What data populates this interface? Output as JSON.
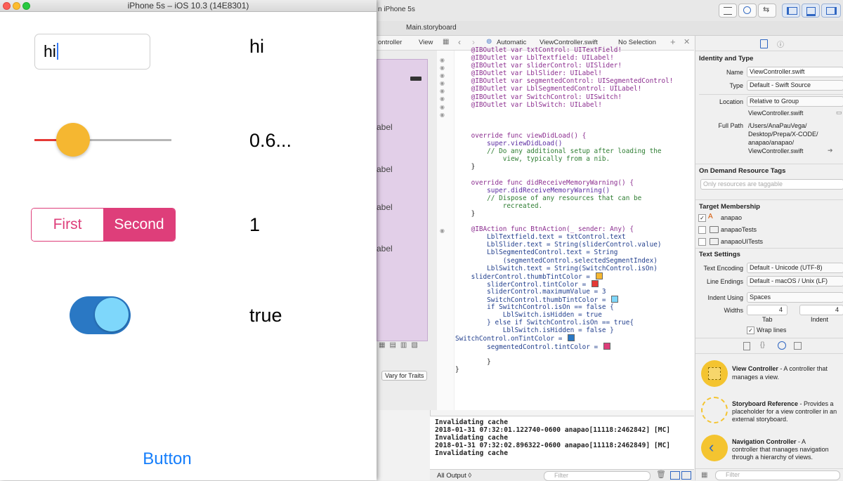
{
  "simulator": {
    "window_title": "iPhone 5s – iOS 10.3 (14E8301)",
    "textfield_value": "hi",
    "textfield_label": "hi",
    "slider": {
      "value_fraction": 0.16,
      "label": "0.6...",
      "min_track_color": "#e53935",
      "thumb_color": "#f5b731"
    },
    "segmented": {
      "items": [
        "First",
        "Second"
      ],
      "selected_index": 1,
      "label": "1",
      "tint": "#de3e7a"
    },
    "switch": {
      "is_on": true,
      "label": "true",
      "on_tint": "#2a78c4",
      "thumb_tint": "#7ed7fb"
    },
    "button_label": "Button"
  },
  "xcode": {
    "toolbar_scheme": "n iPhone 5s",
    "tab_title": "Main.storyboard",
    "jumpbar": {
      "left": "ontroller",
      "left_view": "View",
      "automatic": "Automatic",
      "file": "ViewController.swift",
      "selection": "No Selection"
    },
    "ib_labels": [
      "abel",
      "abel",
      "abel",
      "abel"
    ],
    "ib_toolbar_button": "Vary for Traits",
    "code_lines": [
      "    @IBOutlet var txtControl: UITextField!",
      "    @IBOutlet var LblTextfield: UILabel!",
      "    @IBOutlet var sliderControl: UISlider!",
      "    @IBOutlet var LblSlider: UILabel!",
      "    @IBOutlet var segmentedControl: UISegmentedControl!",
      "    @IBOutlet var LblSegmentedControl: UILabel!",
      "    @IBOutlet var SwitchControl: UISwitch!",
      "    @IBOutlet var LblSwitch: UILabel!",
      "",
      "",
      "",
      "    override func viewDidLoad() {",
      "        super.viewDidLoad()",
      "        // Do any additional setup after loading the",
      "            view, typically from a nib.",
      "    }",
      "",
      "    override func didReceiveMemoryWarning() {",
      "        super.didReceiveMemoryWarning()",
      "        // Dispose of any resources that can be",
      "            recreated.",
      "    }",
      "",
      "    @IBAction func BtnAction(_ sender: Any) {",
      "        LblTextfield.text = txtControl.text",
      "        LblSlider.text = String(sliderControl.value)",
      "        LblSegmentedControl.text = String",
      "            (segmentedControl.selectedSegmentIndex)",
      "        LblSwitch.text = String(SwitchControl.isOn)",
      "    sliderControl.thumbTintColor = ",
      "        sliderControl.tintColor = ",
      "        sliderControl.maximumValue = 3",
      "        SwitchControl.thumbTintColor = ",
      "        if SwitchControl.isOn == false {",
      "            LblSwitch.isHidden = true",
      "        } else if SwitchControl.isOn == true{",
      "            LblSwitch.isHidden = false }",
      "SwitchControl.onTintColor = ",
      "        segmentedControl.tintColor = ",
      "",
      "        }",
      "}"
    ],
    "swatches": [
      {
        "line": 29,
        "color": "#f5b731"
      },
      {
        "line": 30,
        "color": "#e53935"
      },
      {
        "line": 32,
        "color": "#7ed7fb"
      },
      {
        "line": 37,
        "color": "#2a78c4"
      },
      {
        "line": 38,
        "color": "#de3e7a"
      }
    ],
    "console_lines": [
      "Invalidating cache",
      "2018-01-31 07:32:01.122740-0600 anapao[11118:2462842] [MC]",
      "Invalidating cache",
      "2018-01-31 07:32:02.896322-0600 anapao[11118:2462849] [MC]",
      "Invalidating cache"
    ],
    "console_output_label": "All Output ◊",
    "console_filter_placeholder": "Filter",
    "inspector": {
      "identity_header": "Identity and Type",
      "name_label": "Name",
      "name_value": "ViewController.swift",
      "type_label": "Type",
      "type_value": "Default - Swift Source",
      "location_label": "Location",
      "location_value": "Relative to Group",
      "location_file": "ViewController.swift",
      "fullpath_label": "Full Path",
      "fullpath_lines": [
        "/Users/AnaPauVega/",
        "Desktop/Prepa/X-CODE/",
        "anapao/anapao/",
        "ViewController.swift"
      ],
      "odr_header": "On Demand Resource Tags",
      "odr_placeholder": "Only resources are taggable",
      "target_header": "Target Membership",
      "targets": [
        {
          "name": "anapao",
          "checked": true
        },
        {
          "name": "anapaoTests",
          "checked": false
        },
        {
          "name": "anapaoUITests",
          "checked": false
        }
      ],
      "text_header": "Text Settings",
      "encoding_label": "Text Encoding",
      "encoding_value": "Default - Unicode (UTF-8)",
      "line_endings_label": "Line Endings",
      "line_endings_value": "Default - macOS / Unix (LF)",
      "indent_label": "Indent Using",
      "indent_value": "Spaces",
      "widths_label": "Widths",
      "tab_width": "4",
      "indent_width": "4",
      "tab_caption": "Tab",
      "indent_caption": "Indent",
      "wrap_label": "Wrap lines",
      "library": [
        {
          "title": "View Controller",
          "desc1": " - A controller that",
          "desc2": "manages a view.",
          "desc3": ""
        },
        {
          "title": "Storyboard Reference",
          "desc1": " - Provides a",
          "desc2": "placeholder for a view controller in an",
          "desc3": "external storyboard."
        },
        {
          "title": "Navigation Controller",
          "desc1": " - A",
          "desc2": "controller that manages navigation",
          "desc3": "through a hierarchy of views."
        }
      ],
      "filter_placeholder": "Filter"
    }
  }
}
